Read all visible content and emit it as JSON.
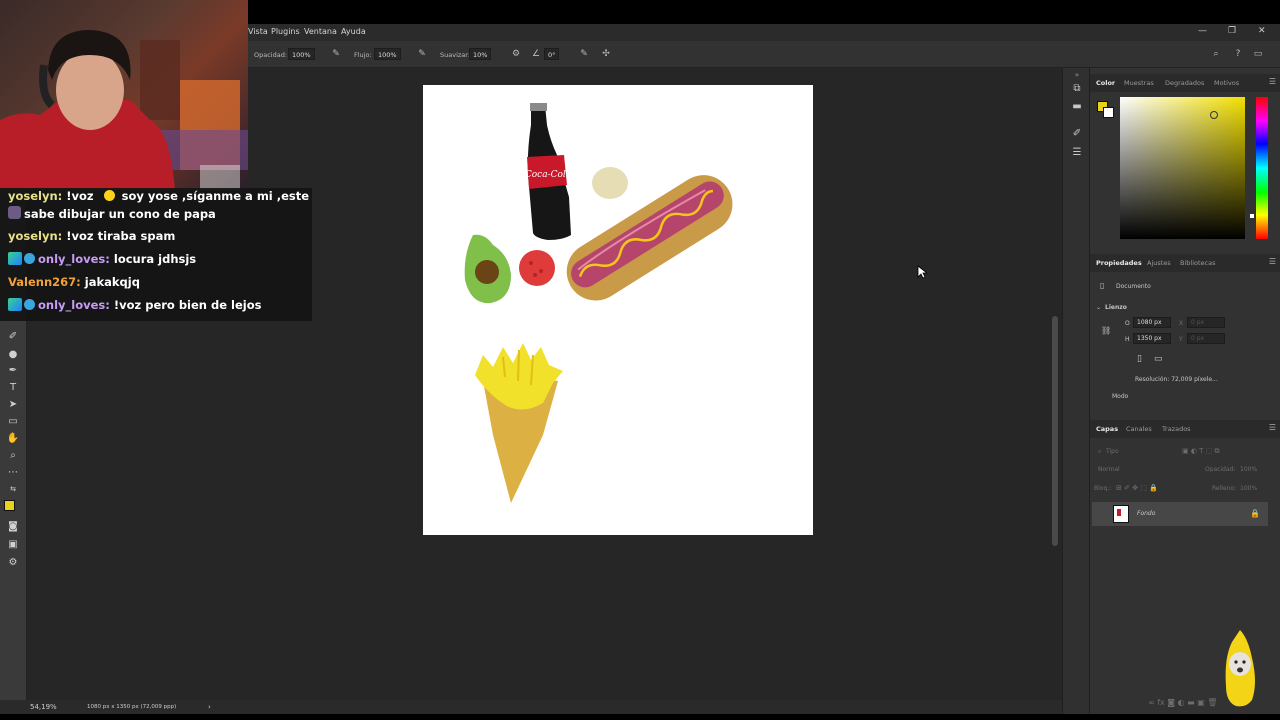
{
  "menubar": {
    "items": [
      "Vista",
      "Plugins",
      "Ventana",
      "Ayuda"
    ],
    "window_controls": [
      "—",
      "❐",
      "✕"
    ]
  },
  "options": {
    "opacity_label": "Opacidad:",
    "opacity_value": "100%",
    "flow_label": "Flujo:",
    "flow_value": "100%",
    "smoothing_label": "Suavizar:",
    "smoothing_value": "10%",
    "angle_value": "0°"
  },
  "status": {
    "zoom": "54,19%",
    "doc_info": "1080 px x 1350 px (72,009 ppp)",
    "arrow": "›"
  },
  "color_panel": {
    "tabs": [
      "Color",
      "Muestras",
      "Degradados",
      "Motivos"
    ],
    "foreground": "#e8d21a",
    "background": "#ffffff"
  },
  "properties_panel": {
    "tabs": [
      "Propiedades",
      "Ajustes",
      "Bibliotecas"
    ],
    "doc_label": "Documento",
    "section": "Lienzo",
    "w_label": "O",
    "w_value": "1080 px",
    "h_label": "H",
    "h_value": "1350 px",
    "x_label": "X",
    "x_value": "0 px",
    "y_label": "Y",
    "y_value": "0 px",
    "resolution": "Resolución: 72,009 píxele...",
    "mode": "Modo"
  },
  "layers_panel": {
    "tabs": [
      "Capas",
      "Canales",
      "Trazados"
    ],
    "search_placeholder": "Tipo",
    "blend_mode": "Normal",
    "opacity_label": "Opacidad:",
    "opacity_value": "100%",
    "lock_label": "Bloq.:",
    "fill_label": "Relleno:",
    "fill_value": "100%",
    "layer_name": "Fondo"
  },
  "chat": {
    "messages": [
      {
        "user": "yoselyn",
        "user_color": "#e8e08a",
        "text": "!voz",
        "text2": " soy yose ,síganme a mi ,este",
        "line2": "sabe dibujar un cono de papa",
        "badge": false
      },
      {
        "user": "yoselyn",
        "user_color": "#e8e08a",
        "text": "!voz tiraba spam",
        "badge": false
      },
      {
        "user": "only_loves",
        "user_color": "#c69cf7",
        "text": "locura jdhsjs",
        "badge": true
      },
      {
        "user": "Valenn267",
        "user_color": "#f2a23c",
        "text": "jakakqjq",
        "badge": false
      },
      {
        "user": "only_loves",
        "user_color": "#c69cf7",
        "text": "!voz pero bien de lejos",
        "badge": true
      }
    ]
  },
  "artwork": {
    "bottle_label": "Coca-Cola"
  }
}
